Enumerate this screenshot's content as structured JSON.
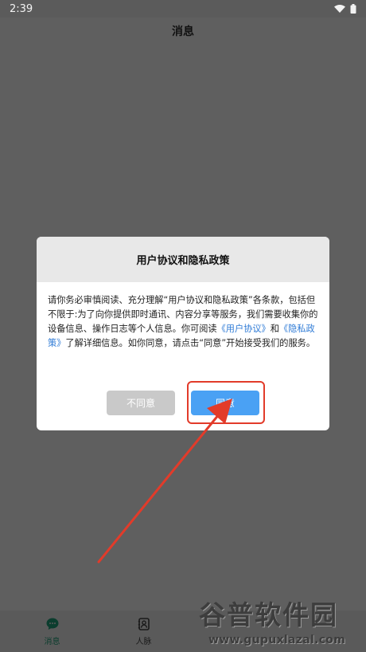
{
  "status_bar": {
    "time": "2:39"
  },
  "app_bar": {
    "title": "消息"
  },
  "dialog": {
    "title": "用户协议和隐私政策",
    "body": {
      "text_1": "请你务必审慎阅读、充分理解“用户协议和隐私政策”各条款，包括但不限于:为了向你提供即时通讯、内容分享等服务，我们需要收集你的设备信息、操作日志等个人信息。你可阅读",
      "link_1": "《用户协议》",
      "text_2": "和",
      "link_2": "《隐私政策》",
      "text_3": "了解详细信息。如你同意，请点击“同意”开始接受我们的服务。"
    },
    "buttons": {
      "disagree": "不同意",
      "agree": "同意"
    }
  },
  "bottom_nav": {
    "items": [
      {
        "label": "消息",
        "icon": "chat-bubble-icon",
        "active": true
      },
      {
        "label": "人脉",
        "icon": "contacts-icon",
        "active": false
      }
    ]
  },
  "watermark": {
    "title": "谷普软件园",
    "url": "www.gupuxlazal.com"
  },
  "colors": {
    "overlay": "#5f5f5f",
    "link": "#2f7bd6",
    "agree_button": "#4aa1f4",
    "disagree_button": "#c9c9c9",
    "highlight": "#e23b2a"
  }
}
